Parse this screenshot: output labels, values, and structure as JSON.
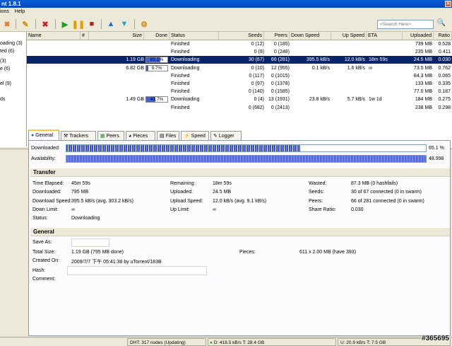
{
  "window": {
    "title": "nt 1.8.1"
  },
  "menu": {
    "items": [
      "ions",
      "Help"
    ]
  },
  "search": {
    "placeholder": "<Search Here>"
  },
  "sidebar": {
    "items": [
      "oading (3)",
      "ted (6)",
      "(3)",
      "e (6)",
      "el (9)",
      "ds"
    ]
  },
  "list": {
    "columns": [
      "Name",
      "#",
      "Size",
      "Done",
      "Status",
      "Seeds",
      "Peers",
      "Down Speed",
      "Up Speed",
      "ETA",
      "Uploaded",
      "Ratio"
    ],
    "rows": [
      {
        "size": "",
        "done": "",
        "done_pct": null,
        "status": "Finished",
        "seeds": "0 (12)",
        "peers": "0 (185)",
        "down": "",
        "up": "",
        "eta": "",
        "uploaded": "739 MB",
        "ratio": "0.528",
        "selected": false
      },
      {
        "size": "",
        "done": "",
        "done_pct": null,
        "status": "Finished",
        "seeds": "0 (9)",
        "peers": "0 (248)",
        "down": "",
        "up": "",
        "eta": "",
        "uploaded": "235 MB",
        "ratio": "0.411",
        "selected": false
      },
      {
        "size": "1.19 GB",
        "done": "65.1%",
        "done_pct": 65.1,
        "status": "Downloading",
        "seeds": "30 (67)",
        "peers": "66 (281)",
        "down": "395.5 kB/s",
        "up": "12.0 kB/s",
        "eta": "18m 59s",
        "uploaded": "24.5 MB",
        "ratio": "0.030",
        "selected": true
      },
      {
        "size": "6.82 GB",
        "done": "9.7%",
        "done_pct": 9.7,
        "status": "Downloading",
        "seeds": "0 (10)",
        "peers": "12 (955)",
        "down": "0.1 kB/s",
        "up": "1.6 kB/s",
        "eta": "∞",
        "uploaded": "73.5 MB",
        "ratio": "0.762",
        "selected": false
      },
      {
        "size": "",
        "done": "",
        "done_pct": null,
        "status": "Finished",
        "seeds": "0 (117)",
        "peers": "0 (1015)",
        "down": "",
        "up": "",
        "eta": "",
        "uploaded": "84.3 MB",
        "ratio": "0.065",
        "selected": false
      },
      {
        "size": "",
        "done": "",
        "done_pct": null,
        "status": "Finished",
        "seeds": "0 (97)",
        "peers": "0 (1378)",
        "down": "",
        "up": "",
        "eta": "",
        "uploaded": "133 MB",
        "ratio": "0.335",
        "selected": false
      },
      {
        "size": "",
        "done": "",
        "done_pct": null,
        "status": "Finished",
        "seeds": "0 (140)",
        "peers": "0 (1585)",
        "down": "",
        "up": "",
        "eta": "",
        "uploaded": "77.0 MB",
        "ratio": "0.187",
        "selected": false
      },
      {
        "size": "1.49 GB",
        "done": "41.7%",
        "done_pct": 41.7,
        "status": "Downloading",
        "seeds": "0 (4)",
        "peers": "13 (1931)",
        "down": "23.8 kB/s",
        "up": "5.7 kB/s",
        "eta": "1w 1d",
        "uploaded": "184 MB",
        "ratio": "0.275",
        "selected": false
      },
      {
        "size": "",
        "done": "",
        "done_pct": null,
        "status": "Finished",
        "seeds": "0 (682)",
        "peers": "0 (2413)",
        "down": "",
        "up": "",
        "eta": "",
        "uploaded": "238 MB",
        "ratio": "0.298",
        "selected": false
      }
    ]
  },
  "tabs": [
    "General",
    "Trackers",
    "Peers",
    "Pieces",
    "Files",
    "Speed",
    "Logger"
  ],
  "general": {
    "downloaded_label": "Downloaded:",
    "downloaded_value": "65.1 %",
    "downloaded_fraction": 0.651,
    "availability_label": "Availability:",
    "availability_value": "48.998",
    "transfer_title": "Transfer",
    "transfer": [
      [
        "Time Elapsed:",
        "45m 59s",
        "Remaining:",
        "18m 59s",
        "Wasted:",
        "87.3 MB (0 hashfails)"
      ],
      [
        "Downloaded:",
        "795 MB",
        "Uploaded:",
        "24.5 MB",
        "Seeds:",
        "30 of 67 connected (0 in swarm)"
      ],
      [
        "Download Speed:",
        "395.5 kB/s (avg. 303.2 kB/s)",
        "Upload Speed:",
        "12.0 kB/s (avg. 9.1 kB/s)",
        "Peers:",
        "66 of 281 connected (0 in swarm)"
      ],
      [
        "Down Limit:",
        "∞",
        "Up Limit:",
        "∞",
        "Share Ratio:",
        "0.030"
      ],
      [
        "Status:",
        "Downloading",
        "",
        "",
        "",
        ""
      ]
    ],
    "general_title": "General",
    "save_as_label": "Save As:",
    "total_size_label": "Total Size:",
    "total_size_value": "1.19 GB (795 MB done)",
    "pieces_label": "Pieces:",
    "pieces_value": "611 x 2.00 MB (have 393)",
    "created_on_label": "Created On:",
    "created_on_value": "2009/7/7 下午 05:41:38 by uTorrent/183B",
    "hash_label": "Hash:",
    "comment_label": "Comment:"
  },
  "status": {
    "dht": "DHT: 317 nodes (Updating)",
    "down": "D: 418.5 kB/s T: 28.4 GB",
    "up": "U: 20.9 kB/s T: 7.5 GB"
  },
  "watermark": "#365695",
  "colors": {
    "title_bar": "#0a5fd8",
    "selection": "#0a246a",
    "progress": "#3a60e0",
    "tab_highlight": "#ffc83c"
  }
}
